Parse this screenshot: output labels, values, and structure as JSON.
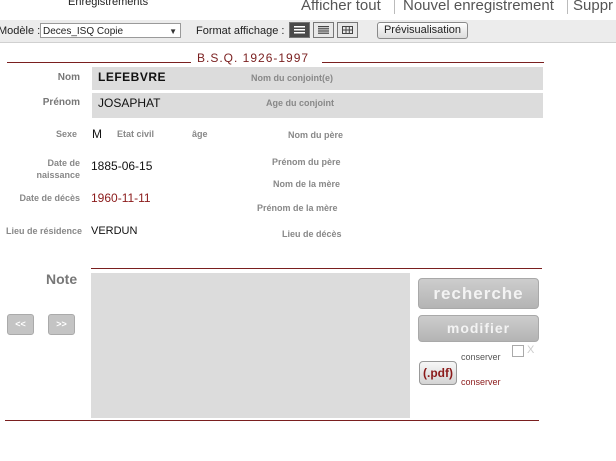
{
  "menu": {
    "enregistrements": "Enregistrements",
    "afficher_tout": "Afficher tout",
    "nouvel_enregistrement": "Nouvel enregistrement",
    "supprimer": "Suppr"
  },
  "toolbar": {
    "modele_label": "Modèle :",
    "modele_value": "Deces_ISQ Copie",
    "format_label": "Format affichage :",
    "preview_label": "Prévisualisation"
  },
  "header": {
    "title": "B.S.Q. 1926-1997"
  },
  "form": {
    "nom_label": "Nom",
    "nom_value": "LEFEBVRE",
    "nom_conjoint_label": "Nom du conjoint(e)",
    "prenom_label": "Prénom",
    "prenom_value": "JOSAPHAT",
    "age_conjoint_label": "Age du conjoint",
    "sexe_label": "Sexe",
    "sexe_value": "M",
    "etat_civil_label": "Etat civil",
    "age_label": "âge",
    "nom_pere_label": "Nom du père",
    "date_naissance_label_1": "Date de",
    "date_naissance_label_2": "naissance",
    "date_naissance_value": "1885-06-15",
    "prenom_pere_label": "Prénom du père",
    "nom_mere_label": "Nom de la mère",
    "date_deces_label": "Date de décès",
    "date_deces_value": "1960-11-11",
    "prenom_mere_label": "Prénom de la mère",
    "lieu_residence_label": "Lieu de résidence",
    "lieu_residence_value": "VERDUN",
    "lieu_deces_label": "Lieu de décès"
  },
  "note": {
    "label": "Note",
    "prev_label": "<<",
    "next_label": ">>",
    "recherche_label": "recherche",
    "modifier_label": "modifier",
    "pdf_label": "(.pdf)",
    "conserver_1": "conserver",
    "conserver_2": "conserver",
    "x_label": "X"
  },
  "colors": {
    "accent": "#7a1f1f",
    "field_bg": "#dcdcdc",
    "button_gray": "#bfbfbf"
  },
  "icons": [
    "list-view-icon",
    "table-view-icon",
    "grid-view-icon",
    "chevron-down-icon"
  ]
}
